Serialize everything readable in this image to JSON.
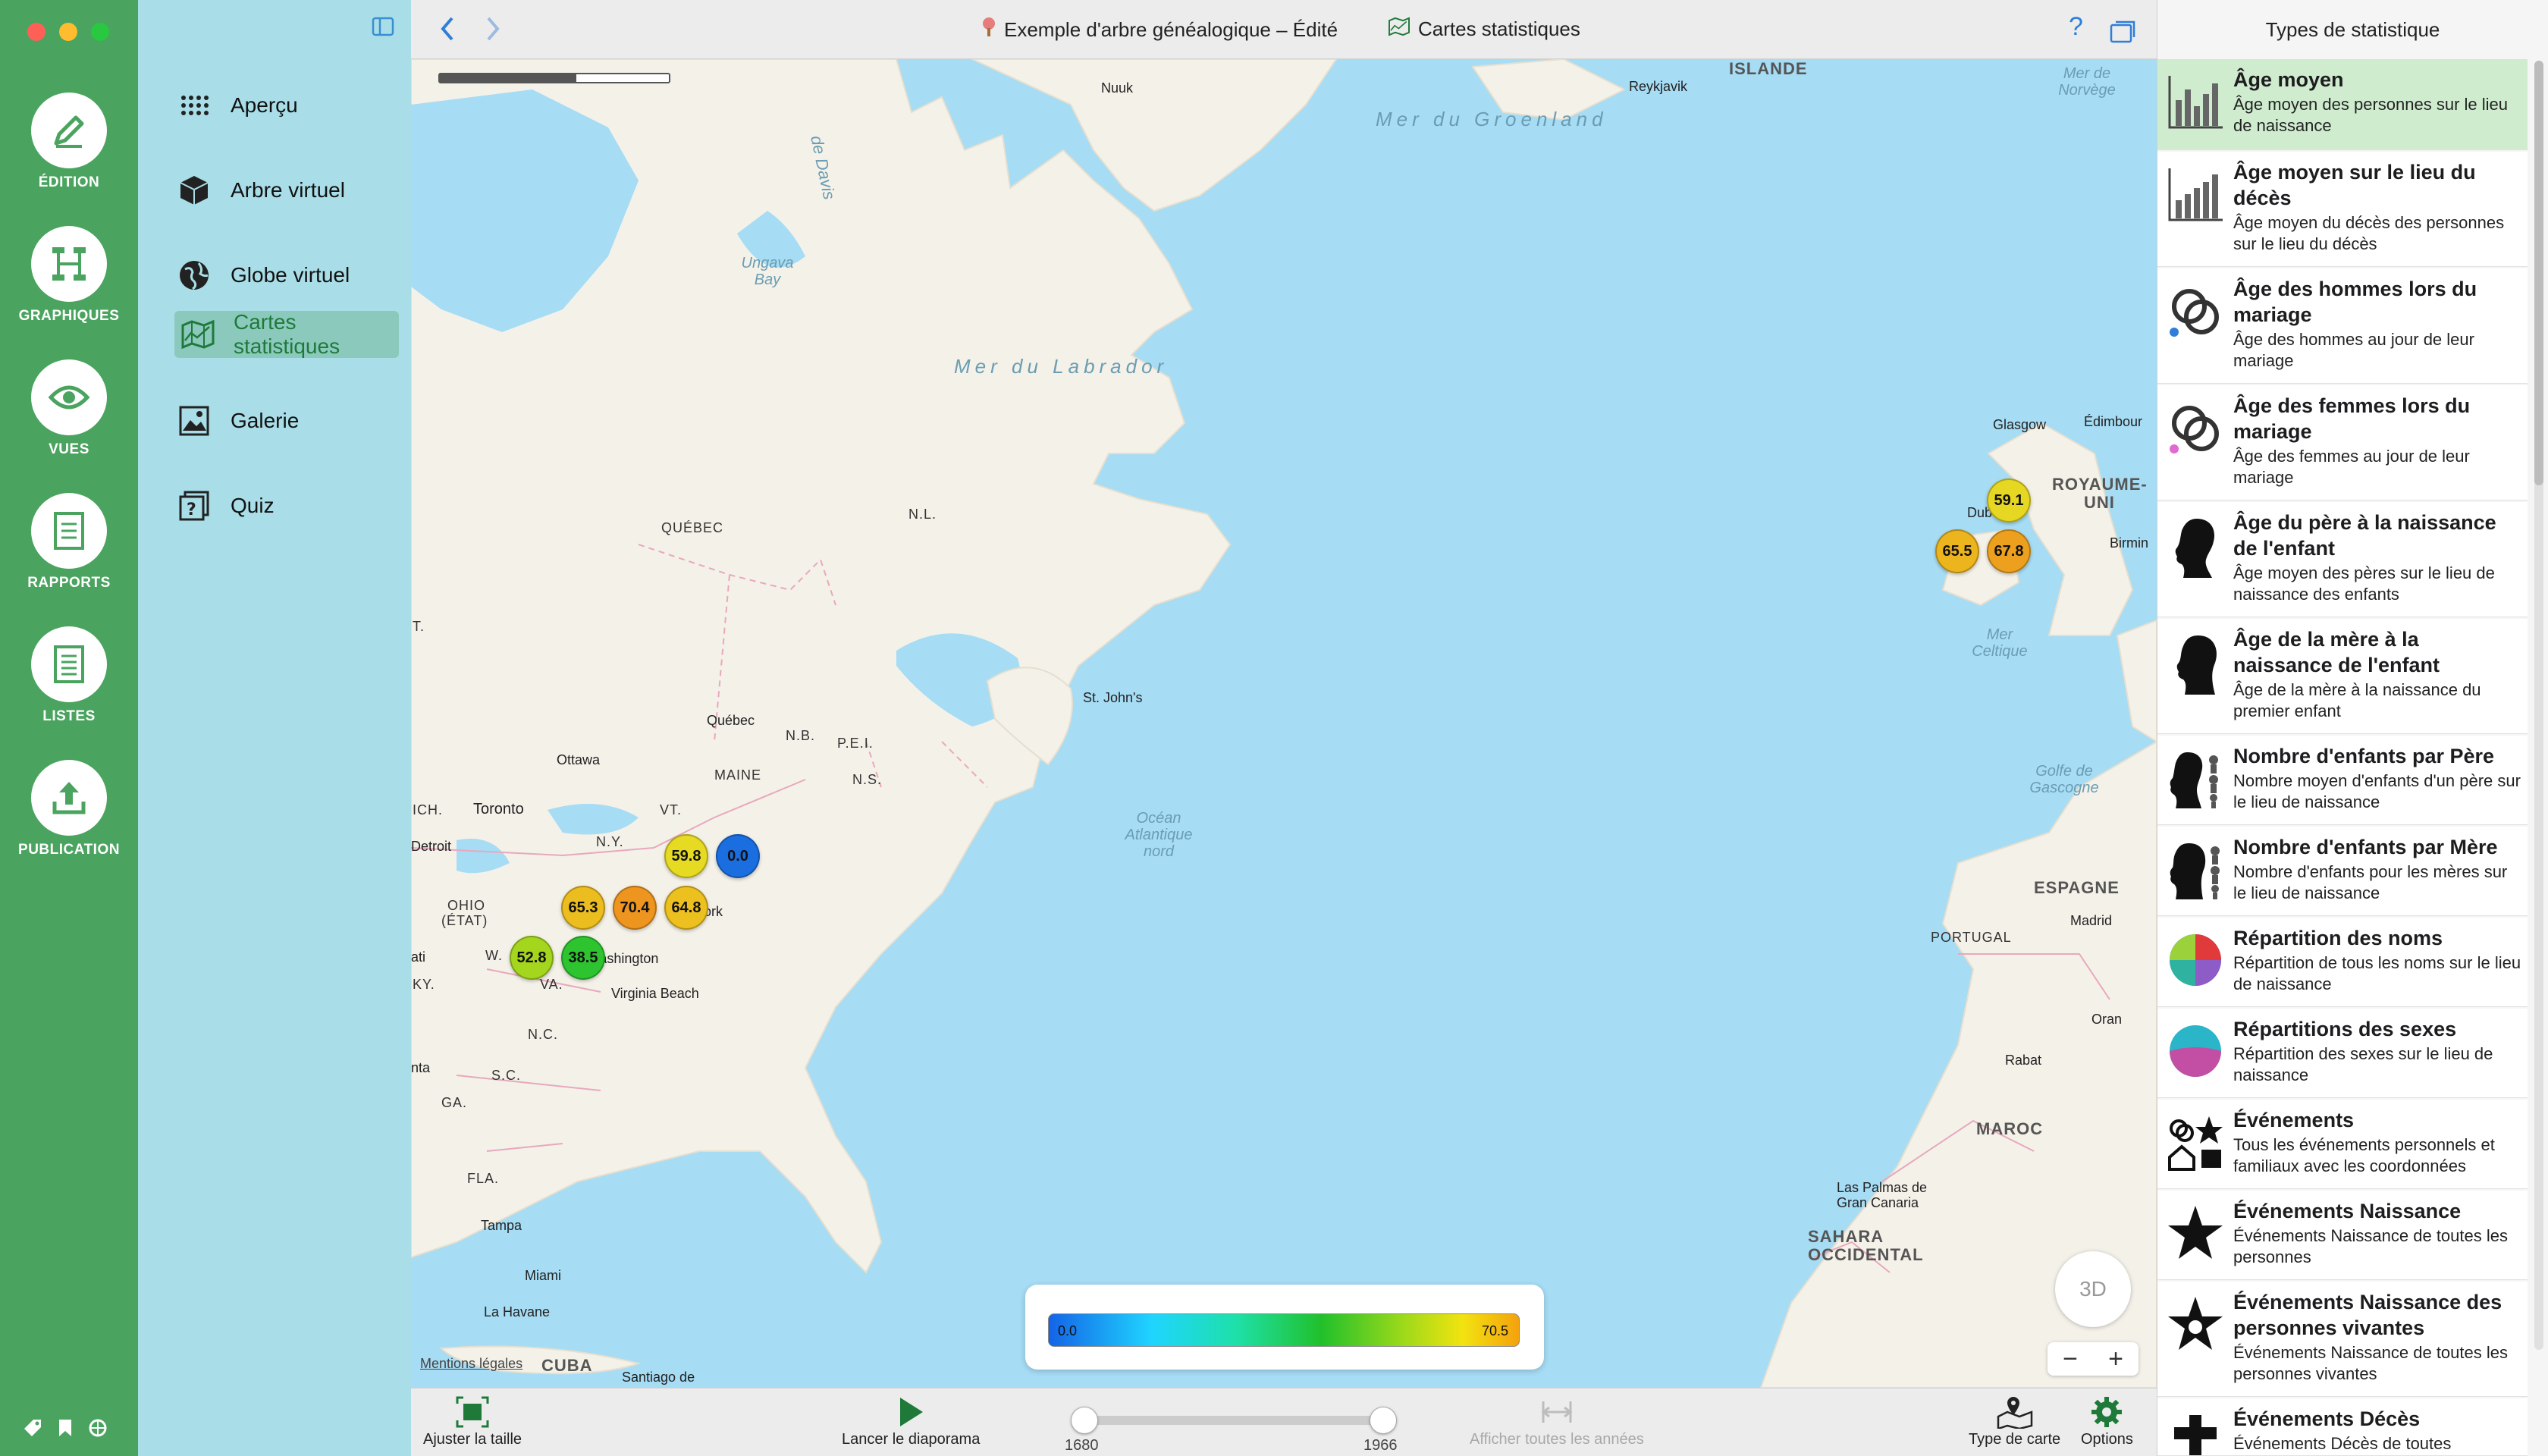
{
  "window": {
    "document_title": "Exemple d'arbre généalogique – Édité",
    "view_title": "Cartes statistiques"
  },
  "rail": {
    "items": [
      {
        "label": "ÉDITION",
        "icon": "pencil-icon"
      },
      {
        "label": "GRAPHIQUES",
        "icon": "chart-tree-icon"
      },
      {
        "label": "VUES",
        "icon": "eye-icon"
      },
      {
        "label": "RAPPORTS",
        "icon": "report-icon"
      },
      {
        "label": "LISTES",
        "icon": "list-icon"
      },
      {
        "label": "PUBLICATION",
        "icon": "upload-icon"
      }
    ]
  },
  "nav": {
    "items": [
      {
        "label": "Aperçu",
        "icon": "grid-icon"
      },
      {
        "label": "Arbre virtuel",
        "icon": "cube-icon"
      },
      {
        "label": "Globe virtuel",
        "icon": "globe-icon"
      },
      {
        "label": "Cartes statistiques",
        "icon": "stat-map-icon",
        "selected": true
      },
      {
        "label": "Galerie",
        "icon": "gallery-icon"
      },
      {
        "label": "Quiz",
        "icon": "quiz-icon"
      }
    ]
  },
  "map": {
    "region_labels": [
      "ISLANDE",
      "ROYAUME-",
      "UNI",
      "QUÉBEC",
      "N.L.",
      "MAINE",
      "N.B.",
      "P.E.I.",
      "N.S.",
      "VT.",
      "N.Y.",
      "OHIO",
      "(ÉTAT)",
      "W.",
      "VA.",
      "N.C.",
      "S.C.",
      "GA.",
      "FLA.",
      "ESPAGNE",
      "PORTUGAL",
      "MAROC",
      "SAHARA",
      "OCCIDENTAL",
      "CUBA",
      "ICH.",
      "KY.",
      "T."
    ],
    "sea_labels": [
      "Mer du Groenland",
      "Mer du Labrador",
      "Océan",
      "Atlantique",
      "nord",
      "Mer",
      "Celtique",
      "Golfe de",
      "Gascogne",
      "Ungava",
      "Bay",
      "de Davis",
      "Mer de",
      "Norvège"
    ],
    "cities": [
      "Reykjavik",
      "Nuuk",
      "Glasgow",
      "Édimbour",
      "Dub",
      "Birmin",
      "St. John's",
      "Québec",
      "Ottawa",
      "Toronto",
      "Detroit",
      "Washington",
      "Virginia Beach",
      "Tampa",
      "Miami",
      "La Havane",
      "Santiago de",
      "Madrid",
      "Rabat",
      "Oran",
      "Las Palmas de",
      "Gran Canaria",
      "ork",
      "ati",
      "nta"
    ],
    "bubbles": [
      "59.1",
      "65.5",
      "67.8",
      "59.8",
      "0.0",
      "65.3",
      "70.4",
      "64.8",
      "52.8",
      "38.5"
    ],
    "legend": {
      "min": "0.0",
      "max": "70.5"
    },
    "compass_label": "3D",
    "zoom_minus": "−",
    "zoom_plus": "+",
    "legal": "Mentions légales"
  },
  "bottom": {
    "fit": "Ajuster la taille",
    "slideshow": "Lancer le diaporama",
    "year_start": "1680",
    "year_end": "1966",
    "show_all": "Afficher toutes les années",
    "map_type": "Type de carte",
    "options": "Options"
  },
  "panel": {
    "title": "Types de statistique",
    "items": [
      {
        "title": "Âge moyen",
        "desc": "Âge moyen des personnes sur le lieu de naissance",
        "icon": "bar-chart-icon",
        "selected": true
      },
      {
        "title": "Âge moyen sur le lieu du décès",
        "desc": "Âge moyen du décès des personnes sur le lieu du décès",
        "icon": "bar-chart-icon"
      },
      {
        "title": "Âge des hommes lors du mariage",
        "desc": "Âge des hommes au jour de leur mariage",
        "icon": "rings-icon"
      },
      {
        "title": "Âge des femmes lors du mariage",
        "desc": "Âge des femmes au jour de leur mariage",
        "icon": "rings-icon"
      },
      {
        "title": "Âge du père à la naissance de l'enfant",
        "desc": "Âge moyen des pères sur le lieu de naissance des enfants",
        "icon": "male-silhouette-icon"
      },
      {
        "title": "Âge de la mère à la naissance de l'enfant",
        "desc": "Âge de la mère à la naissance du premier enfant",
        "icon": "female-silhouette-icon"
      },
      {
        "title": "Nombre d'enfants par Père",
        "desc": "Nombre moyen d'enfants d'un père sur le lieu de naissance",
        "icon": "father-children-icon"
      },
      {
        "title": "Nombre d'enfants par Mère",
        "desc": "Nombre d'enfants pour les mères sur le lieu de naissance",
        "icon": "mother-children-icon"
      },
      {
        "title": "Répartition des noms",
        "desc": "Répartition de tous les noms sur le lieu de naissance",
        "icon": "pie-icon"
      },
      {
        "title": "Répartitions des sexes",
        "desc": "Répartition des sexes sur le lieu de naissance",
        "icon": "gender-pie-icon"
      },
      {
        "title": "Événements",
        "desc": "Tous les événements personnels et familiaux avec les coordonnées",
        "icon": "events-icon"
      },
      {
        "title": "Événements Naissance",
        "desc": "Événements Naissance de toutes les personnes",
        "icon": "star-icon"
      },
      {
        "title": "Événements Naissance des personnes vivantes",
        "desc": "Événements Naissance de toutes les personnes vivantes",
        "icon": "star-outline-icon"
      },
      {
        "title": "Événements Décès",
        "desc": "Événements Décès de toutes",
        "icon": "cross-icon"
      }
    ]
  }
}
